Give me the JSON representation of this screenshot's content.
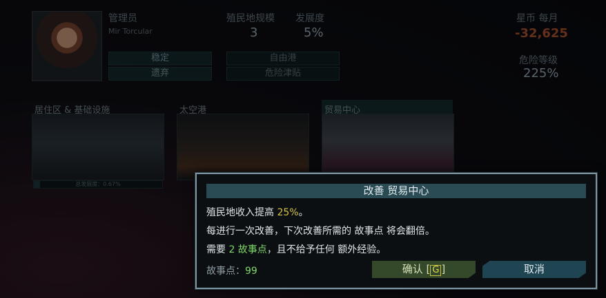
{
  "admin": {
    "title_label": "管理员",
    "name": "Mir Torcular",
    "buttons": [
      "稳定",
      "遗弃"
    ],
    "tags": [
      "自由港",
      "危险津贴"
    ]
  },
  "stats": {
    "colony_size_label": "殖民地规模",
    "colony_size_value": "3",
    "development_label": "发展度",
    "development_value": "5%",
    "credits_label": "星币 每月",
    "credits_value": "-32,625",
    "danger_label": "危险等级",
    "danger_value": "225%"
  },
  "facilities": [
    {
      "title": "居住区 & 基础设施"
    },
    {
      "title": "太空港"
    },
    {
      "title": "贸易中心"
    }
  ],
  "progress": {
    "text": "总发展度：0.67%",
    "percent": 0.67
  },
  "dialog": {
    "title": "改善 贸易中心",
    "line1_prefix": "殖民地收入提高 ",
    "line1_value": "25%",
    "line1_suffix": "。",
    "line2": "每进行一次改善，下次改善所需的 故事点 将会翻倍。",
    "line3_prefix": "需要 ",
    "line3_value": "2 故事点",
    "line3_suffix": "，且不给予任何 额外经验。",
    "story_points_label": "故事点：",
    "story_points_value": "99",
    "confirm_label": "确认 [",
    "confirm_key": "G",
    "confirm_suffix": "]",
    "cancel_label": "取消"
  },
  "colors": {
    "dialog_border": "#7e97a3",
    "highlight_yellow": "#d8c14a",
    "highlight_green": "#7fd86a",
    "confirm_bg": "#33492a",
    "cancel_bg": "#1f4552"
  }
}
